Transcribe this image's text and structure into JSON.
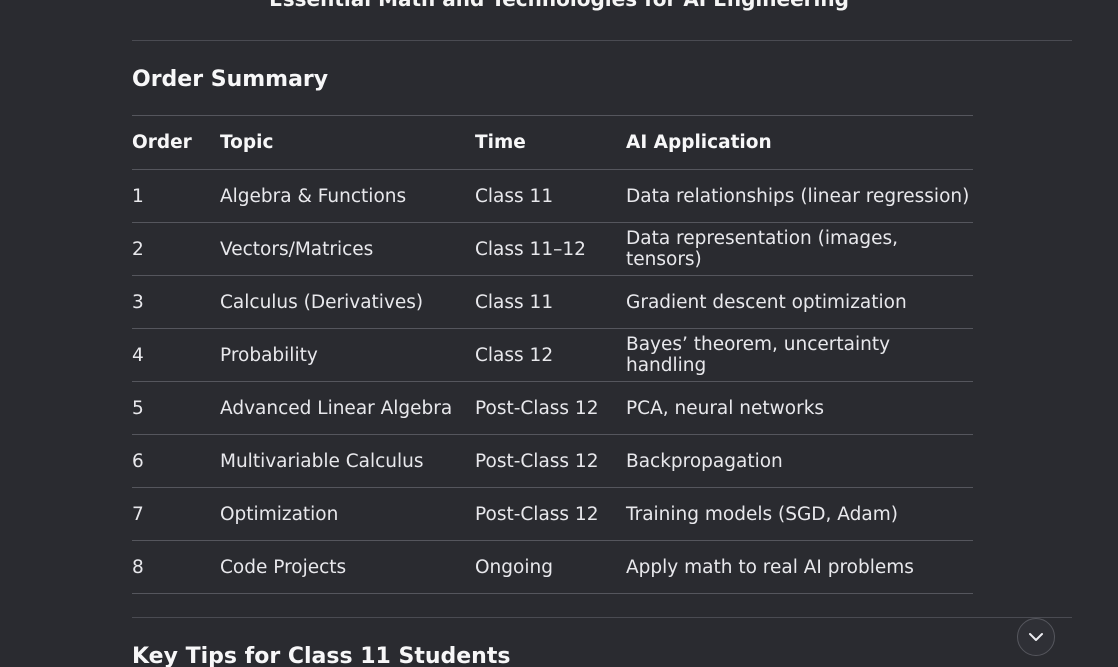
{
  "top_heading": "Essential Math and Technologies for AI Engineering",
  "section_title": "Order Summary",
  "table": {
    "headers": {
      "order": "Order",
      "topic": "Topic",
      "time": "Time",
      "application": "AI Application"
    },
    "rows": [
      {
        "order": "1",
        "topic": "Algebra & Functions",
        "time": "Class 11",
        "application": "Data relationships (linear regression)"
      },
      {
        "order": "2",
        "topic": "Vectors/Matrices",
        "time": "Class 11–12",
        "application": "Data representation (images, tensors)"
      },
      {
        "order": "3",
        "topic": "Calculus (Derivatives)",
        "time": "Class 11",
        "application": "Gradient descent optimization"
      },
      {
        "order": "4",
        "topic": "Probability",
        "time": "Class 12",
        "application": "Bayes’ theorem, uncertainty handling"
      },
      {
        "order": "5",
        "topic": "Advanced Linear Algebra",
        "time": "Post-Class 12",
        "application": "PCA, neural networks"
      },
      {
        "order": "6",
        "topic": "Multivariable Calculus",
        "time": "Post-Class 12",
        "application": "Backpropagation"
      },
      {
        "order": "7",
        "topic": "Optimization",
        "time": "Post-Class 12",
        "application": "Training models (SGD, Adam)"
      },
      {
        "order": "8",
        "topic": "Code Projects",
        "time": "Ongoing",
        "application": "Apply math to real AI problems"
      }
    ]
  },
  "next_section_title": "Key Tips for Class 11 Students",
  "scroll_button": {
    "icon": "chevron-down-icon"
  }
}
